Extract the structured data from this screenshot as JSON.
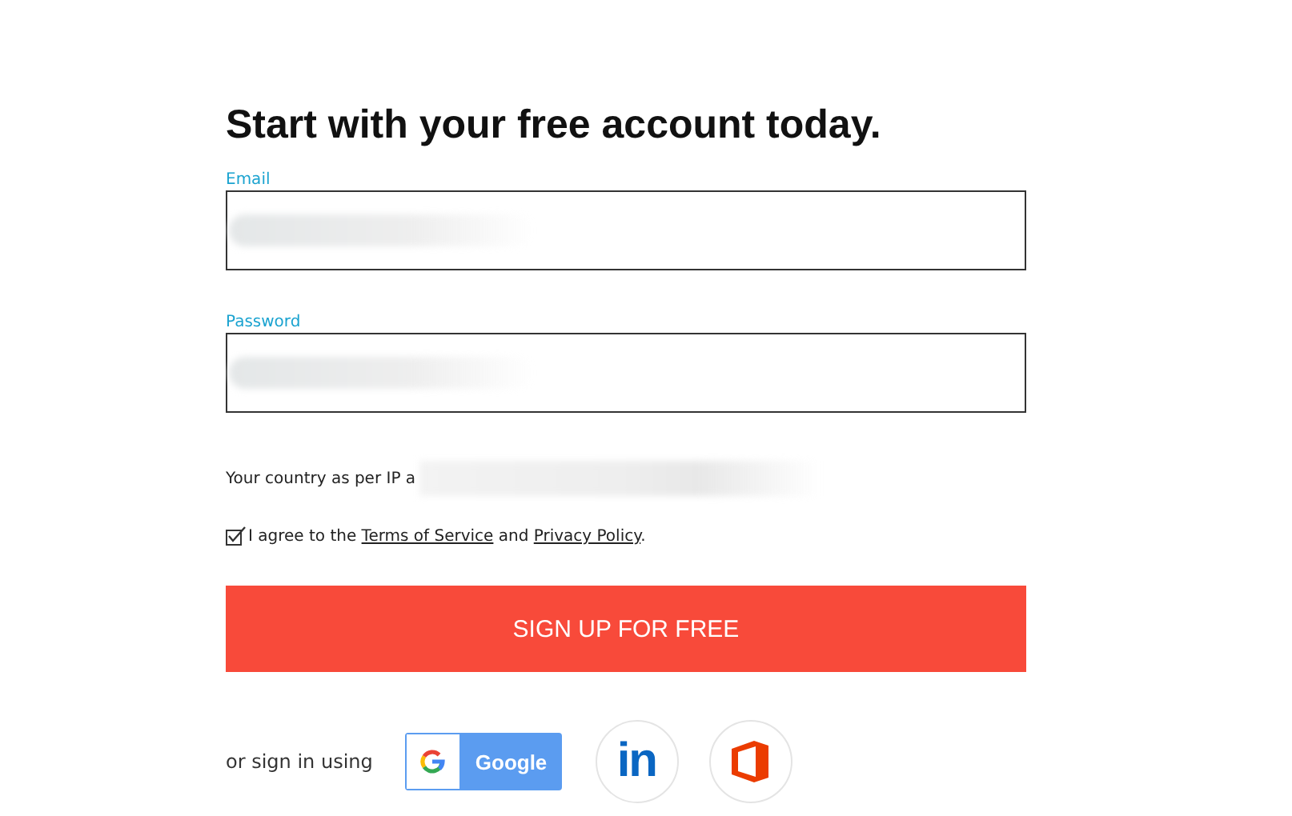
{
  "heading": "Start with your free account today.",
  "fields": [
    {
      "label": "Email"
    },
    {
      "label": "Password"
    }
  ],
  "country_note": "Your country as per IP a",
  "agreement": {
    "checked": true,
    "prefix": "I agree to the",
    "terms": "Terms of Service",
    "middle": "and",
    "privacy": "Privacy Policy",
    "suffix": "."
  },
  "signup_button": "SIGN UP FOR FREE",
  "social": {
    "label": "or sign in using",
    "google": "Google",
    "linkedin": "in"
  }
}
